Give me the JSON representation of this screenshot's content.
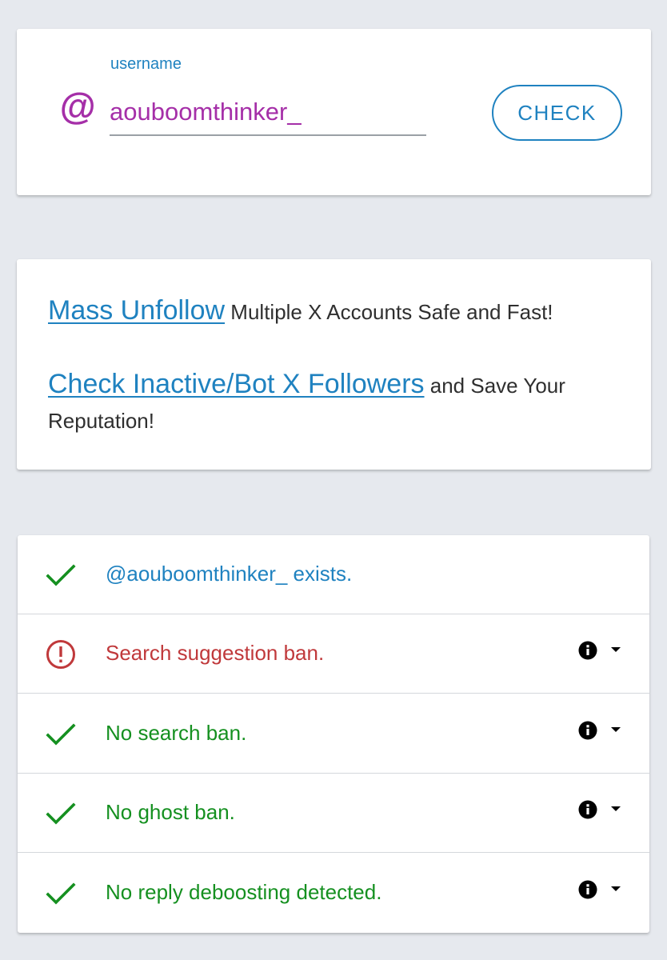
{
  "colors": {
    "page_background": "#e6e9ee",
    "accent_blue": "#1f82c0",
    "username_purple": "#a52fa8",
    "success_green": "#159020",
    "error_red": "#c0393b",
    "promo_text": "#2f2f2f"
  },
  "username_form": {
    "label": "username",
    "prefix_symbol": "@",
    "value": "aouboomthinker_",
    "check_button_label": "CHECK"
  },
  "promo": {
    "line1_link": "Mass Unfollow",
    "line1_text": " Multiple X Accounts Safe and Fast!",
    "line2_link": "Check Inactive/Bot X Followers",
    "line2_text": " and Save Your Reputation!"
  },
  "results": [
    {
      "status": "ok",
      "icon": "checkmark-icon",
      "text": "@aouboomthinker_ exists.",
      "color": "#1f82c0",
      "has_info": false
    },
    {
      "status": "error",
      "icon": "alert-circle-icon",
      "text": "Search suggestion ban.",
      "color": "#c0393b",
      "has_info": true
    },
    {
      "status": "ok",
      "icon": "checkmark-icon",
      "text": "No search ban.",
      "color": "#159020",
      "has_info": true
    },
    {
      "status": "ok",
      "icon": "checkmark-icon",
      "text": "No ghost ban.",
      "color": "#159020",
      "has_info": true
    },
    {
      "status": "ok",
      "icon": "checkmark-icon",
      "text": "No reply deboosting detected.",
      "color": "#159020",
      "has_info": true
    }
  ]
}
